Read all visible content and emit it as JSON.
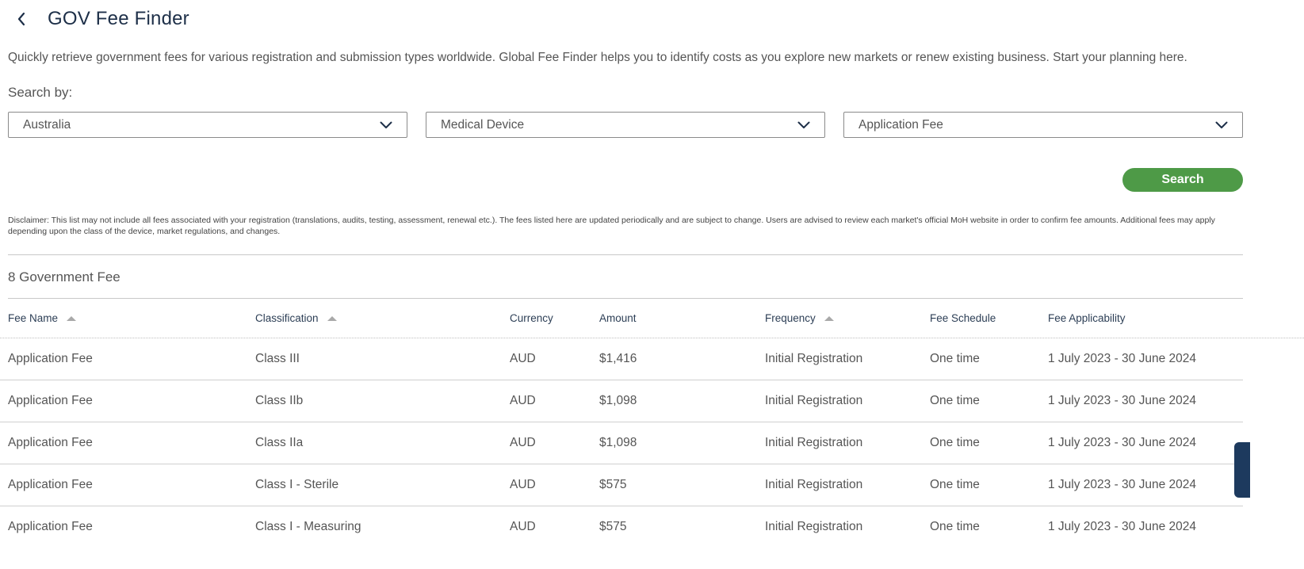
{
  "header": {
    "title": "GOV Fee Finder"
  },
  "intro": "Quickly retrieve government fees for various registration and submission types worldwide. Global Fee Finder helps you to identify costs as you explore new markets or renew existing business. Start your planning here.",
  "search": {
    "label": "Search by:",
    "country": "Australia",
    "product": "Medical Device",
    "fee_type": "Application Fee",
    "button": "Search"
  },
  "disclaimer": "Disclaimer: This list may not include all fees associated with your registration (translations, audits, testing, assessment, renewal etc.). The fees listed here are updated periodically and are subject to change. Users are advised to review each market's official MoH website in order to confirm fee amounts. Additional fees may apply depending upon the class of the device, market regulations, and changes.",
  "results": {
    "count_label": "8 Government Fee"
  },
  "table": {
    "columns": [
      "Fee Name",
      "Classification",
      "Currency",
      "Amount",
      "Frequency",
      "Fee Schedule",
      "Fee Applicability"
    ],
    "rows": [
      [
        "Application Fee",
        "Class III",
        "AUD",
        "$1,416",
        "Initial Registration",
        "One time",
        "1 July 2023 - 30 June 2024"
      ],
      [
        "Application Fee",
        "Class IIb",
        "AUD",
        "$1,098",
        "Initial Registration",
        "One time",
        "1 July 2023 - 30 June 2024"
      ],
      [
        "Application Fee",
        "Class IIa",
        "AUD",
        "$1,098",
        "Initial Registration",
        "One time",
        "1 July 2023 - 30 June 2024"
      ],
      [
        "Application Fee",
        "Class I - Sterile",
        "AUD",
        "$575",
        "Initial Registration",
        "One time",
        "1 July 2023 - 30 June 2024"
      ],
      [
        "Application Fee",
        "Class I - Measuring",
        "AUD",
        "$575",
        "Initial Registration",
        "One time",
        "1 July 2023 - 30 June 2024"
      ]
    ]
  },
  "colors": {
    "accent_green": "#4e9a47",
    "title_navy": "#1d2f48",
    "side_tab": "#1d3a5e"
  },
  "icons": {
    "back": "chevron-left-icon",
    "dropdown": "chevron-down-icon",
    "sort": "sort-up-icon"
  }
}
